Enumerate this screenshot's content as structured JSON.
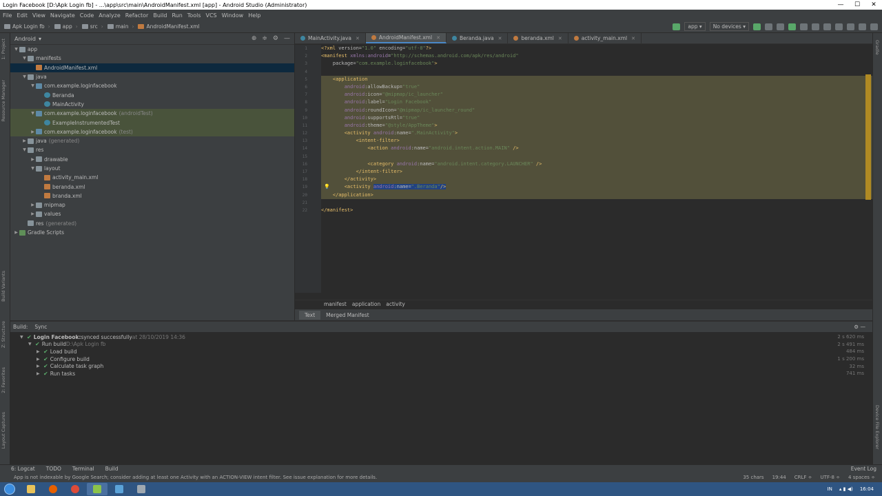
{
  "window": {
    "title": "Login Facebook [D:\\Apk Login fb] - ...\\app\\src\\main\\AndroidManifest.xml [app] - Android Studio (Administrator)",
    "min": "—",
    "max": "☐",
    "close": "✕"
  },
  "menu": [
    "File",
    "Edit",
    "View",
    "Navigate",
    "Code",
    "Analyze",
    "Refactor",
    "Build",
    "Run",
    "Tools",
    "VCS",
    "Window",
    "Help"
  ],
  "nav": {
    "crumbs": [
      "Apk Login fb",
      "app",
      "src",
      "main",
      "AndroidManifest.xml"
    ],
    "run_config": "app",
    "device": "No devices"
  },
  "left_strip": [
    "1: Project",
    "Resource Manager",
    "Build Variants",
    "Z: Structure",
    "2: Favorites",
    "Layout Captures"
  ],
  "right_strip": [
    "Gradle",
    "Device File Explorer"
  ],
  "project": {
    "view": "Android",
    "tree": [
      {
        "d": 0,
        "arr": "▼",
        "ic": "folder",
        "label": "app",
        "muted": ""
      },
      {
        "d": 1,
        "arr": "▼",
        "ic": "folder",
        "label": "manifests",
        "muted": ""
      },
      {
        "d": 2,
        "arr": "",
        "ic": "xml",
        "label": "AndroidManifest.xml",
        "muted": "",
        "sel": true
      },
      {
        "d": 1,
        "arr": "▼",
        "ic": "folder",
        "label": "java",
        "muted": ""
      },
      {
        "d": 2,
        "arr": "▼",
        "ic": "java",
        "label": "com.example.loginfacebook",
        "muted": ""
      },
      {
        "d": 3,
        "arr": "",
        "ic": "cls",
        "label": "Beranda",
        "muted": ""
      },
      {
        "d": 3,
        "arr": "",
        "ic": "cls",
        "label": "MainActivity",
        "muted": ""
      },
      {
        "d": 2,
        "arr": "▼",
        "ic": "java",
        "label": "com.example.loginfacebook",
        "muted": "(androidTest)",
        "test": true
      },
      {
        "d": 3,
        "arr": "",
        "ic": "cls",
        "label": "ExampleInstrumentedTest",
        "muted": "",
        "test": true
      },
      {
        "d": 2,
        "arr": "▶",
        "ic": "java",
        "label": "com.example.loginfacebook",
        "muted": "(test)",
        "test": true
      },
      {
        "d": 1,
        "arr": "▶",
        "ic": "folder",
        "label": "java",
        "muted": "(generated)"
      },
      {
        "d": 1,
        "arr": "▼",
        "ic": "folder",
        "label": "res",
        "muted": ""
      },
      {
        "d": 2,
        "arr": "▶",
        "ic": "folder",
        "label": "drawable",
        "muted": ""
      },
      {
        "d": 2,
        "arr": "▼",
        "ic": "folder",
        "label": "layout",
        "muted": ""
      },
      {
        "d": 3,
        "arr": "",
        "ic": "xml",
        "label": "activity_main.xml",
        "muted": ""
      },
      {
        "d": 3,
        "arr": "",
        "ic": "xml",
        "label": "beranda.xml",
        "muted": ""
      },
      {
        "d": 3,
        "arr": "",
        "ic": "xml",
        "label": "branda.xml",
        "muted": ""
      },
      {
        "d": 2,
        "arr": "▶",
        "ic": "folder",
        "label": "mipmap",
        "muted": ""
      },
      {
        "d": 2,
        "arr": "▶",
        "ic": "folder",
        "label": "values",
        "muted": ""
      },
      {
        "d": 1,
        "arr": "",
        "ic": "folder",
        "label": "res",
        "muted": "(generated)"
      },
      {
        "d": 0,
        "arr": "▶",
        "ic": "gradle",
        "label": "Gradle Scripts",
        "muted": ""
      }
    ]
  },
  "tabs": [
    {
      "label": "MainActivity.java",
      "color": "#3e86a0",
      "active": false
    },
    {
      "label": "AndroidManifest.xml",
      "color": "#c07a40",
      "active": true
    },
    {
      "label": "Beranda.java",
      "color": "#3e86a0",
      "active": false
    },
    {
      "label": "beranda.xml",
      "color": "#c07a40",
      "active": false
    },
    {
      "label": "activity_main.xml",
      "color": "#c07a40",
      "active": false
    }
  ],
  "code": [
    {
      "n": "1",
      "h": false,
      "parts": [
        [
          "tag",
          "<?xml "
        ],
        [
          "attr",
          "version="
        ],
        [
          "val",
          "\"1.0\""
        ],
        [
          "attr",
          " encoding="
        ],
        [
          "val",
          "\"utf-8\""
        ],
        [
          "tag",
          "?>"
        ]
      ]
    },
    {
      "n": "2",
      "h": false,
      "parts": [
        [
          "tag",
          "<manifest "
        ],
        [
          "ns",
          "xmlns:android"
        ],
        [
          "attr",
          "="
        ],
        [
          "val",
          "\"http://schemas.android.com/apk/res/android\""
        ]
      ]
    },
    {
      "n": "3",
      "h": false,
      "parts": [
        [
          "attr",
          "    package="
        ],
        [
          "val",
          "\"com.example.loginfacebook\""
        ],
        [
          "tag",
          ">"
        ]
      ]
    },
    {
      "n": "4",
      "h": false,
      "parts": [
        [
          "attr",
          ""
        ]
      ]
    },
    {
      "n": "5",
      "h": true,
      "parts": [
        [
          "tag",
          "    <application"
        ]
      ]
    },
    {
      "n": "6",
      "h": true,
      "parts": [
        [
          "ns",
          "        android"
        ],
        [
          "attr",
          ":allowBackup="
        ],
        [
          "val",
          "\"true\""
        ]
      ]
    },
    {
      "n": "7",
      "h": true,
      "parts": [
        [
          "ns",
          "        android"
        ],
        [
          "attr",
          ":icon="
        ],
        [
          "val",
          "\"@mipmap/ic_launcher\""
        ]
      ]
    },
    {
      "n": "8",
      "h": true,
      "parts": [
        [
          "ns",
          "        android"
        ],
        [
          "attr",
          ":label="
        ],
        [
          "val",
          "\"Login Facebook\""
        ]
      ]
    },
    {
      "n": "9",
      "h": true,
      "parts": [
        [
          "ns",
          "        android"
        ],
        [
          "attr",
          ":roundIcon="
        ],
        [
          "val",
          "\"@mipmap/ic_launcher_round\""
        ]
      ]
    },
    {
      "n": "10",
      "h": true,
      "parts": [
        [
          "ns",
          "        android"
        ],
        [
          "attr",
          ":supportsRtl="
        ],
        [
          "val",
          "\"true\""
        ]
      ]
    },
    {
      "n": "11",
      "h": true,
      "parts": [
        [
          "ns",
          "        android"
        ],
        [
          "attr",
          ":theme="
        ],
        [
          "val",
          "\"@style/AppTheme\""
        ],
        [
          "tag",
          ">"
        ]
      ]
    },
    {
      "n": "12",
      "h": true,
      "parts": [
        [
          "tag",
          "        <activity "
        ],
        [
          "ns",
          "android"
        ],
        [
          "attr",
          ":name="
        ],
        [
          "val",
          "\".MainActivity\""
        ],
        [
          "tag",
          ">"
        ]
      ]
    },
    {
      "n": "13",
      "h": true,
      "parts": [
        [
          "tag",
          "            <intent-filter>"
        ]
      ]
    },
    {
      "n": "14",
      "h": true,
      "parts": [
        [
          "tag",
          "                <action "
        ],
        [
          "ns",
          "android"
        ],
        [
          "attr",
          ":name="
        ],
        [
          "val",
          "\"android.intent.action.MAIN\""
        ],
        [
          "tag",
          " />"
        ]
      ]
    },
    {
      "n": "15",
      "h": true,
      "parts": [
        [
          "attr",
          ""
        ]
      ]
    },
    {
      "n": "16",
      "h": true,
      "parts": [
        [
          "tag",
          "                <category "
        ],
        [
          "ns",
          "android"
        ],
        [
          "attr",
          ":name="
        ],
        [
          "val",
          "\"android.intent.category.LAUNCHER\""
        ],
        [
          "tag",
          " />"
        ]
      ]
    },
    {
      "n": "17",
      "h": true,
      "parts": [
        [
          "tag",
          "            </intent-filter>"
        ]
      ]
    },
    {
      "n": "18",
      "h": true,
      "parts": [
        [
          "tag",
          "        </activity>"
        ]
      ]
    },
    {
      "n": "19",
      "h": true,
      "parts": [
        [
          "tag",
          "        <activity "
        ],
        [
          "ns",
          "android"
        ],
        [
          "attr",
          ":name="
        ],
        [
          "val",
          "\".Beranda\""
        ],
        [
          "tag",
          "/>"
        ]
      ]
    },
    {
      "n": "20",
      "h": true,
      "parts": [
        [
          "tag",
          "    </application>"
        ]
      ]
    },
    {
      "n": "21",
      "h": false,
      "parts": [
        [
          "attr",
          ""
        ]
      ]
    },
    {
      "n": "22",
      "h": false,
      "parts": [
        [
          "tag",
          "</manifest>"
        ]
      ]
    }
  ],
  "editor_breadcrumbs": [
    "manifest",
    "application",
    "activity"
  ],
  "editor_tabs": [
    "Text",
    "Merged Manifest"
  ],
  "build": {
    "tabs": [
      "Build:",
      "Sync"
    ],
    "rows": [
      {
        "d": 0,
        "arr": "▼",
        "bold": "Login Facebook:",
        "text": " synced successfully",
        "muted": " at 28/10/2019 14:36",
        "time": "2 s 620 ms"
      },
      {
        "d": 1,
        "arr": "▼",
        "bold": "",
        "text": "Run build",
        "muted": " D:\\Apk Login fb",
        "time": "2 s 491 ms"
      },
      {
        "d": 2,
        "arr": "▶",
        "bold": "",
        "text": "Load build",
        "muted": "",
        "time": "484 ms"
      },
      {
        "d": 2,
        "arr": "▶",
        "bold": "",
        "text": "Configure build",
        "muted": "",
        "time": "1 s 200 ms"
      },
      {
        "d": 2,
        "arr": "▶",
        "bold": "",
        "text": "Calculate task graph",
        "muted": "",
        "time": "32 ms"
      },
      {
        "d": 2,
        "arr": "▶",
        "bold": "",
        "text": "Run tasks",
        "muted": "",
        "time": "741 ms"
      }
    ]
  },
  "bottom_tools": [
    "6: Logcat",
    "TODO",
    "Terminal",
    "Build"
  ],
  "event_log": "Event Log",
  "status": {
    "message": "App is not indexable by Google Search; consider adding at least one Activity with an ACTION-VIEW intent filter. See issue explanation for more details.",
    "chars": "35 chars",
    "pos": "19:44",
    "crlf": "CRLF ÷",
    "enc": "UTF-8 ÷",
    "indent": "4 spaces ÷"
  },
  "taskbar": {
    "lang": "IN",
    "clock": "16:04"
  },
  "colors": {
    "accent": "#4a88c7",
    "highlight": "#52503a",
    "warning_stripe": "#b08a23"
  }
}
